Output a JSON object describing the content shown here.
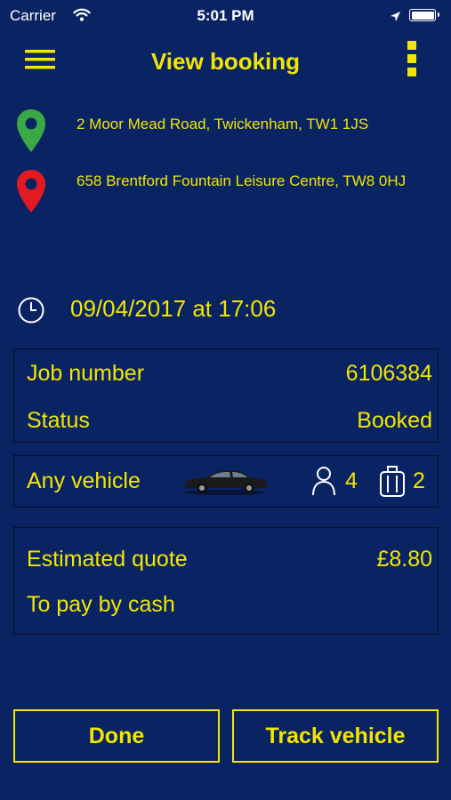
{
  "status_bar": {
    "carrier": "Carrier",
    "time": "5:01 PM"
  },
  "header": {
    "title": "View booking",
    "menu_icon": "hamburger-menu-icon",
    "more_icon": "kebab-more-icon"
  },
  "pickup": {
    "address": "2 Moor Mead Road, Twickenham, TW1 1JS",
    "icon": "map-pin-icon",
    "color": "#3aa845"
  },
  "dropoff": {
    "address": "658 Brentford Fountain Leisure Centre, TW8 0HJ",
    "icon": "map-pin-icon",
    "color": "#e21b23"
  },
  "booking_time": {
    "text": "09/04/2017 at 17:06",
    "icon": "clock-icon"
  },
  "job": {
    "job_number_label": "Job number",
    "job_number": "6106384",
    "status_label": "Status",
    "status": "Booked"
  },
  "vehicle": {
    "type": "Any vehicle",
    "passengers": "4",
    "luggage": "2"
  },
  "quote": {
    "label": "Estimated quote",
    "amount": "£8.80",
    "payment": "To pay by cash"
  },
  "buttons": {
    "done": "Done",
    "track": "Track vehicle"
  },
  "theme": {
    "background": "#0a2463",
    "accent": "#f2e600"
  }
}
